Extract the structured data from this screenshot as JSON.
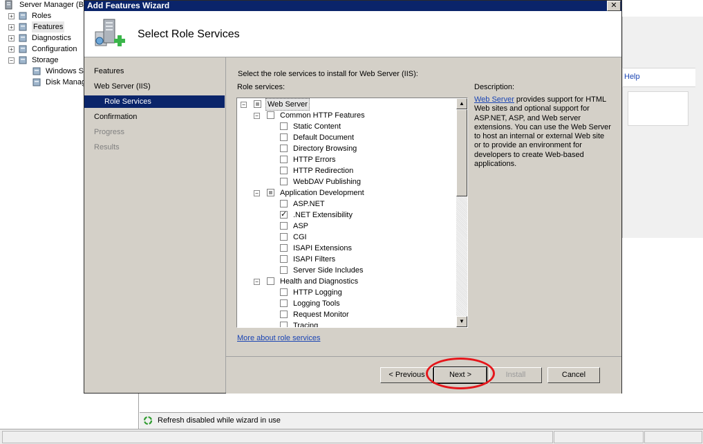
{
  "server_manager": {
    "title": "Server Manager (B",
    "tree": [
      {
        "label": "Roles",
        "expander": "+",
        "icon": "roles-icon"
      },
      {
        "label": "Features",
        "expander": "+",
        "icon": "features-icon"
      },
      {
        "label": "Diagnostics",
        "expander": "+",
        "icon": "diagnostics-icon"
      },
      {
        "label": "Configuration",
        "expander": "+",
        "icon": "configuration-icon"
      },
      {
        "label": "Storage",
        "expander": "−",
        "icon": "storage-icon"
      },
      {
        "label": "Windows Se",
        "icon": "windows-server-backup-icon"
      },
      {
        "label": "Disk Manag",
        "icon": "disk-management-icon"
      }
    ],
    "help_label": "Help",
    "status_text": "Refresh disabled while wizard in use"
  },
  "wizard": {
    "title": "Add Features Wizard",
    "close_label": "✕",
    "header_title": "Select Role Services",
    "nav": [
      {
        "label": "Features"
      },
      {
        "label": "Web Server (IIS)"
      },
      {
        "label": "Role Services"
      },
      {
        "label": "Confirmation"
      },
      {
        "label": "Progress"
      },
      {
        "label": "Results"
      }
    ],
    "instruction": "Select the role services to install for Web Server (IIS):",
    "role_services_label": "Role services:",
    "role_services": [
      {
        "label": "Web Server",
        "level": 0,
        "expander": "−",
        "state": "indeterminate"
      },
      {
        "label": "Common HTTP Features",
        "level": 1,
        "expander": "−",
        "state": "unchecked"
      },
      {
        "label": "Static Content",
        "level": 2,
        "state": "unchecked"
      },
      {
        "label": "Default Document",
        "level": 2,
        "state": "unchecked"
      },
      {
        "label": "Directory Browsing",
        "level": 2,
        "state": "unchecked"
      },
      {
        "label": "HTTP Errors",
        "level": 2,
        "state": "unchecked"
      },
      {
        "label": "HTTP Redirection",
        "level": 2,
        "state": "unchecked"
      },
      {
        "label": "WebDAV Publishing",
        "level": 2,
        "state": "unchecked"
      },
      {
        "label": "Application Development",
        "level": 1,
        "expander": "−",
        "state": "indeterminate"
      },
      {
        "label": "ASP.NET",
        "level": 2,
        "state": "unchecked"
      },
      {
        "label": ".NET Extensibility",
        "level": 2,
        "state": "checked"
      },
      {
        "label": "ASP",
        "level": 2,
        "state": "unchecked"
      },
      {
        "label": "CGI",
        "level": 2,
        "state": "unchecked"
      },
      {
        "label": "ISAPI Extensions",
        "level": 2,
        "state": "unchecked"
      },
      {
        "label": "ISAPI Filters",
        "level": 2,
        "state": "unchecked"
      },
      {
        "label": "Server Side Includes",
        "level": 2,
        "state": "unchecked"
      },
      {
        "label": "Health and Diagnostics",
        "level": 1,
        "expander": "−",
        "state": "unchecked"
      },
      {
        "label": "HTTP Logging",
        "level": 2,
        "state": "unchecked"
      },
      {
        "label": "Logging Tools",
        "level": 2,
        "state": "unchecked"
      },
      {
        "label": "Request Monitor",
        "level": 2,
        "state": "unchecked"
      },
      {
        "label": "Tracing",
        "level": 2,
        "state": "unchecked"
      }
    ],
    "more_link": "More about role services",
    "description_label": "Description:",
    "description_link": "Web Server",
    "description_text": " provides support for HTML Web sites and optional support for ASP.NET, ASP, and Web server extensions. You can use the Web Server to host an internal or external Web site or to provide an environment for developers to create Web-based applications.",
    "buttons": {
      "previous": "< Previous",
      "next": "Next >",
      "install": "Install",
      "cancel": "Cancel"
    },
    "scroll_up": "▲",
    "scroll_down": "▼"
  },
  "colors": {
    "title_bar": "#0a246a",
    "annotation": "#e5161b",
    "link": "#1a44b3"
  }
}
